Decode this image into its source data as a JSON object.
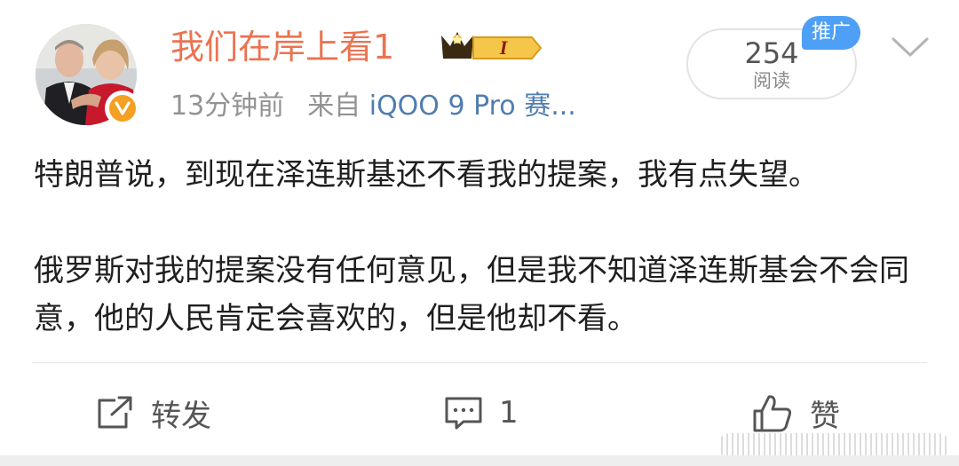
{
  "post": {
    "author": {
      "name": "我们在岸上看1",
      "rank_badge": "I",
      "verified_icon": "v-verified-icon"
    },
    "time": "13分钟前",
    "source_prefix": "来自",
    "source_device": "iQOO 9 Pro 赛...",
    "reads": {
      "count": "254",
      "label": "阅读"
    },
    "promo_label": "推广",
    "paragraphs": [
      "特朗普说，到现在泽连斯基还不看我的提案，我有点失望。",
      "俄罗斯对我的提案没有任何意见，但是我不知道泽连斯基会不会同意，他的人民肯定会喜欢的，但是他却不看。"
    ]
  },
  "actions": {
    "repost_label": "转发",
    "comment_count": "1",
    "like_label": "赞"
  },
  "colors": {
    "username": "#eb7350",
    "meta": "#939393",
    "device": "#507daf",
    "promo": "#4e9ff6",
    "verified": "#f3a023"
  },
  "icons": [
    "chevron-down-icon",
    "repost-icon",
    "comment-icon",
    "like-icon"
  ]
}
